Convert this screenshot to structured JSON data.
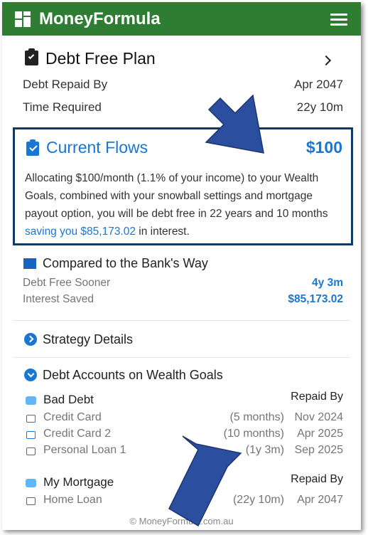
{
  "header": {
    "title": "MoneyFormula",
    "brand_color": "#2e7d32"
  },
  "plan": {
    "title": "Debt Free Plan",
    "rows": [
      {
        "label": "Debt Repaid By",
        "value": "Apr 2047"
      },
      {
        "label": "Time Required",
        "value": "22y 10m"
      }
    ]
  },
  "flows": {
    "title": "Current Flows",
    "amount": "$100",
    "description": "Allocating $100/month (1.1% of your income) to your Wealth Goals, combined with your snowball settings and mortgage payout option, you will be debt free in 22 years and 10 months",
    "savings": "saving you $85,173.02",
    "suffix": " in interest."
  },
  "bank": {
    "title": "Compared to the Bank's Way",
    "rows": [
      {
        "label": "Debt Free Sooner",
        "value": "4y 3m"
      },
      {
        "label": "Interest Saved",
        "value": "$85,173.02"
      }
    ]
  },
  "strategy": {
    "title": "Strategy Details"
  },
  "accounts": {
    "title": "Debt Accounts on Wealth Goals",
    "groups": [
      {
        "name": "Bad Debt",
        "column_label": "Repaid By",
        "items": [
          {
            "name": "Credit Card",
            "duration": "(5 months)",
            "date": "Nov 2024"
          },
          {
            "name": "Credit Card 2",
            "duration": "(10 months)",
            "date": "Apr 2025"
          },
          {
            "name": "Personal Loan 1",
            "duration": "(1y 3m)",
            "date": "Sep 2025"
          }
        ]
      },
      {
        "name": "My Mortgage",
        "column_label": "Repaid By",
        "items": [
          {
            "name": "Home Loan",
            "duration": "(22y 10m)",
            "date": "Apr 2047"
          }
        ]
      }
    ]
  },
  "footer": {
    "text": "© MoneyFormula.com.au"
  },
  "colors": {
    "accent": "#1976d2",
    "highlight_border": "#0d3b66",
    "arrow": "#2b4f9e"
  }
}
